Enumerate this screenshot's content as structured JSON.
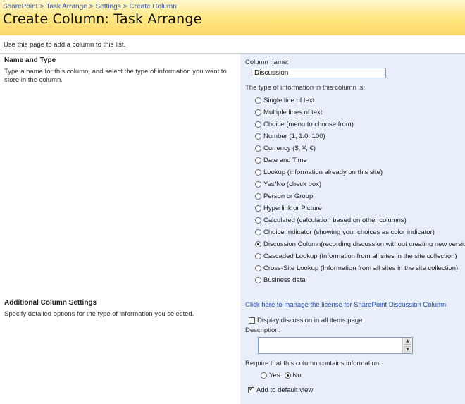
{
  "breadcrumb": {
    "items": [
      "SharePoint",
      "Task Arrange",
      "Settings",
      "Create Column"
    ],
    "separator": ">"
  },
  "page": {
    "title": "Create Column: Task Arrange",
    "intro": "Use this page to add a column to this list."
  },
  "name_type": {
    "title": "Name and Type",
    "description": "Type a name for this column, and select the type of information you want to store in the column.",
    "column_name_label": "Column name:",
    "column_name_value": "Discussion",
    "type_label": "The type of information in this column is:",
    "types": [
      {
        "label": "Single line of text",
        "checked": false
      },
      {
        "label": "Multiple lines of text",
        "checked": false
      },
      {
        "label": "Choice (menu to choose from)",
        "checked": false
      },
      {
        "label": "Number (1, 1.0, 100)",
        "checked": false
      },
      {
        "label": "Currency ($, ¥, €)",
        "checked": false
      },
      {
        "label": "Date and Time",
        "checked": false
      },
      {
        "label": "Lookup (information already on this site)",
        "checked": false
      },
      {
        "label": "Yes/No (check box)",
        "checked": false
      },
      {
        "label": "Person or Group",
        "checked": false
      },
      {
        "label": "Hyperlink or Picture",
        "checked": false
      },
      {
        "label": "Calculated (calculation based on other columns)",
        "checked": false
      },
      {
        "label": "Choice Indicator (showing your choices as color indicator)",
        "checked": false
      },
      {
        "label": "Discussion Column(recording discussion without creating new version)",
        "checked": true
      },
      {
        "label": "Cascaded Lookup (Information from all sites in the site collection)",
        "checked": false
      },
      {
        "label": "Cross-Site Lookup (Information from all sites in the site collection)",
        "checked": false
      },
      {
        "label": "Business data",
        "checked": false
      }
    ]
  },
  "additional": {
    "title": "Additional Column Settings",
    "description": "Specify detailed options for the type of information you selected.",
    "license_link": "Click here to manage the license for SharePoint Discussion Column",
    "display_discussion_label": "Display discussion in all items page",
    "display_discussion_checked": false,
    "description_label": "Description:",
    "description_value": "",
    "require_label": "Require that this column contains information:",
    "require_yes": "Yes",
    "require_no": "No",
    "require_value": "No",
    "add_default_view_label": "Add to default view",
    "add_default_view_checked": true
  },
  "colors": {
    "title_band": "#fcd86a",
    "link": "#1f4bb0",
    "right_panel": "#e9eefb"
  }
}
